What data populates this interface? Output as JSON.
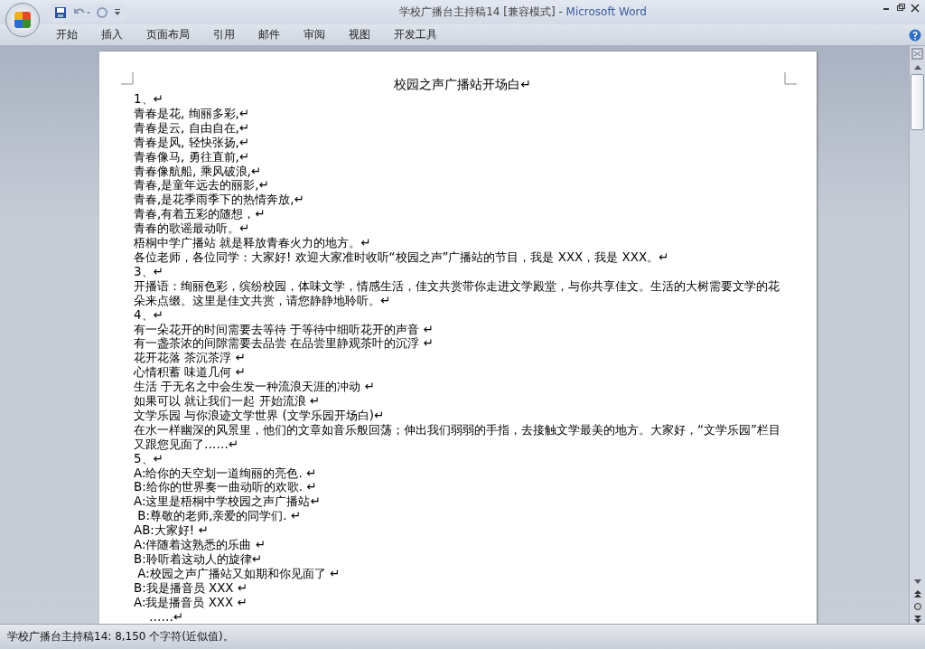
{
  "window": {
    "document_title": "学校广播台主持稿14 [兼容模式] -",
    "app_name": "Microsoft Word"
  },
  "ribbon_tabs": [
    {
      "label": "开始",
      "selected": false
    },
    {
      "label": "插入",
      "selected": false
    },
    {
      "label": "页面布局",
      "selected": false
    },
    {
      "label": "引用",
      "selected": false
    },
    {
      "label": "邮件",
      "selected": false
    },
    {
      "label": "审阅",
      "selected": false
    },
    {
      "label": "视图",
      "selected": false
    },
    {
      "label": "开发工具",
      "selected": false
    }
  ],
  "document": {
    "title": "校园之声广播站开场白↵",
    "paragraphs": [
      "1、↵",
      "青春是花, 绚丽多彩,↵",
      "青春是云, 自由自在,↵",
      "青春是风, 轻快张扬,↵",
      "青春像马, 勇往直前,↵",
      "青春像航船, 乘风破浪,↵",
      "青春,是童年远去的丽影,↵",
      "青春,是花季雨季下的热情奔放,↵",
      "青春,有着五彩的随想，↵",
      "青春的歌谣最动听。↵",
      "梧桐中学广播站 就是释放青春火力的地方。↵",
      "各位老师，各位同学：大家好! 欢迎大家准时收听“校园之声”广播站的节目，我是 XXX，我是 XXX。↵",
      "3、↵",
      "开播语：绚丽色彩，缤纷校园，体味文学，情感生活，佳文共赏带你走进文学殿堂，与你共享佳文。生活的大树需要文学的花朵来点缀。这里是佳文共赏，请您静静地聆听。↵",
      "4、↵",
      "有一朵花开的时间需要去等待 于等待中细听花开的声音 ↵",
      "有一盏茶浓的间隙需要去品尝 在品尝里静观茶叶的沉浮 ↵",
      "花开花落 茶沉茶浮 ↵",
      "心情积蓄 味道几何 ↵",
      "生活 于无名之中会生发一种流浪天涯的冲动 ↵",
      "如果可以 就让我们一起 开始流浪 ↵",
      "文学乐园 与你浪迹文学世界 (文学乐园开场白)↵",
      "在水一样幽深的风景里，他们的文章如音乐般回荡；伸出我们弱弱的手指，去接触文学最美的地方。大家好，“文学乐园”栏目又跟您见面了……↵",
      "5、↵",
      "A:给你的天空划一道绚丽的亮色. ↵",
      "B:给你的世界奏一曲动听的欢歌. ↵",
      "A:这里是梧桐中学校园之声广播站↵",
      " B:尊敬的老师,亲爱的同学们. ↵",
      "AB:大家好! ↵",
      "A:伴随着这熟悉的乐曲 ↵",
      "B:聆听着这动人的旋律↵",
      " A:校园之声广播站又如期和你见面了 ↵",
      "B:我是播音员 XXX ↵",
      "A:我是播音员 XXX ↵",
      "    ……↵"
    ]
  },
  "status_bar": {
    "text": "学校广播台主持稿14: 8,150 个字符(近似值)。"
  }
}
